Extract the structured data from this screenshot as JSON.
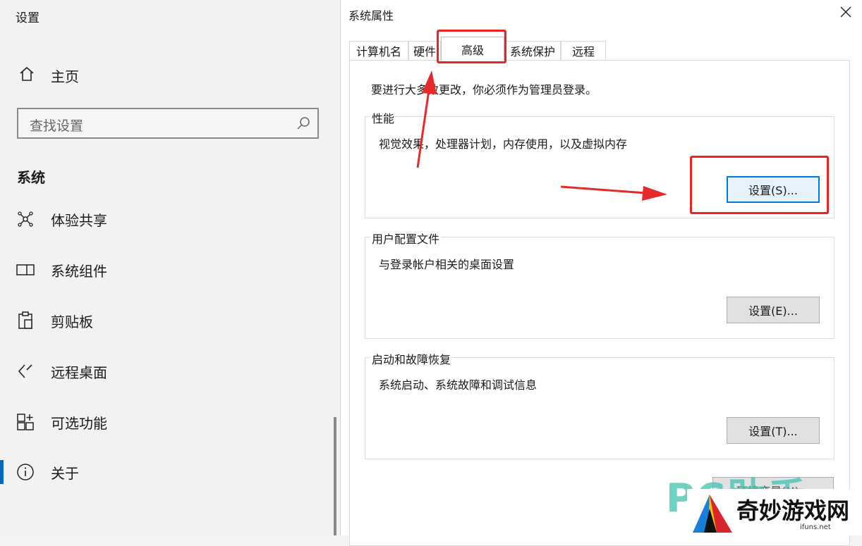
{
  "settings": {
    "window_title": "设置",
    "home_label": "主页",
    "search_placeholder": "查找设置",
    "section_title": "系统",
    "nav_items": [
      {
        "label": "体验共享",
        "icon": "share-icon"
      },
      {
        "label": "系统组件",
        "icon": "component-icon"
      },
      {
        "label": "剪贴板",
        "icon": "clipboard-icon"
      },
      {
        "label": "远程桌面",
        "icon": "remote-desktop-icon"
      },
      {
        "label": "可选功能",
        "icon": "optional-features-icon"
      },
      {
        "label": "关于",
        "icon": "info-icon",
        "selected": true
      }
    ],
    "accent_color": "#0067c0"
  },
  "dialog": {
    "title": "系统属性",
    "tabs": [
      "计算机名",
      "硬件",
      "高级",
      "系统保护",
      "远程"
    ],
    "active_tab": "高级",
    "notice": "要进行大多数更改，你必须作为管理员登录。",
    "performance": {
      "title": "性能",
      "description": "视觉效果，处理器计划，内存使用，以及虚拟内存",
      "button": "设置(S)..."
    },
    "user_profiles": {
      "title": "用户配置文件",
      "description": "与登录帐户相关的桌面设置",
      "button": "设置(E)..."
    },
    "startup_recovery": {
      "title": "启动和故障恢复",
      "description": "系统启动、系统故障和调试信息",
      "button": "设置(T)..."
    },
    "env_button": "环境变量(N)..."
  },
  "annotation_color": "#ee2222",
  "watermark": {
    "pc_text": "PC助手",
    "site_name": "奇妙游戏网",
    "site_url": "ifuns.net"
  }
}
